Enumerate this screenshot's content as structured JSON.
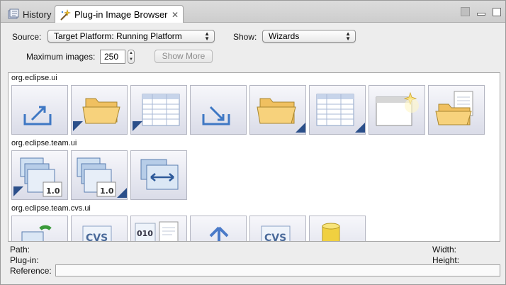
{
  "tabs": [
    {
      "label": "History",
      "active": false
    },
    {
      "label": "Plug-in Image Browser",
      "active": true,
      "closeable": true
    }
  ],
  "controls": {
    "source_label": "Source:",
    "source_value": "Target Platform: Running Platform",
    "show_label": "Show:",
    "show_value": "Wizards",
    "max_images_label": "Maximum images:",
    "max_images_value": "250",
    "show_more_label": "Show More",
    "show_more_enabled": false
  },
  "groups": [
    {
      "name": "org.eclipse.ui",
      "images": [
        "export-wizard-icon",
        "open-folder-wizard-icon",
        "table-wizard-icon",
        "import-wizard-icon",
        "new-folder-wizard-icon",
        "table-new-wizard-icon",
        "new-window-wizard-icon",
        "new-file-folder-wizard-icon"
      ]
    },
    {
      "name": "org.eclipse.team.ui",
      "images": [
        "versioned-project-wizard-icon",
        "versioned-project-new-wizard-icon",
        "synchronize-wizard-icon"
      ]
    },
    {
      "name": "org.eclipse.team.cvs.ui",
      "images": [
        "cvs-checkout-icon",
        "cvs-new-location-icon",
        "binary-files-icon",
        "cvs-share-icon",
        "cvs-repository-icon",
        "database-icon"
      ]
    }
  ],
  "details": {
    "path_label": "Path:",
    "plugin_label": "Plug-in:",
    "reference_label": "Reference:",
    "width_label": "Width:",
    "height_label": "Height:"
  },
  "colors": {
    "tab_active": "#ffffff",
    "tile_top": "#f7f7fb",
    "tile_bottom": "#dadce8",
    "folder": "#f2c35a",
    "arrow": "#3f78c4"
  }
}
